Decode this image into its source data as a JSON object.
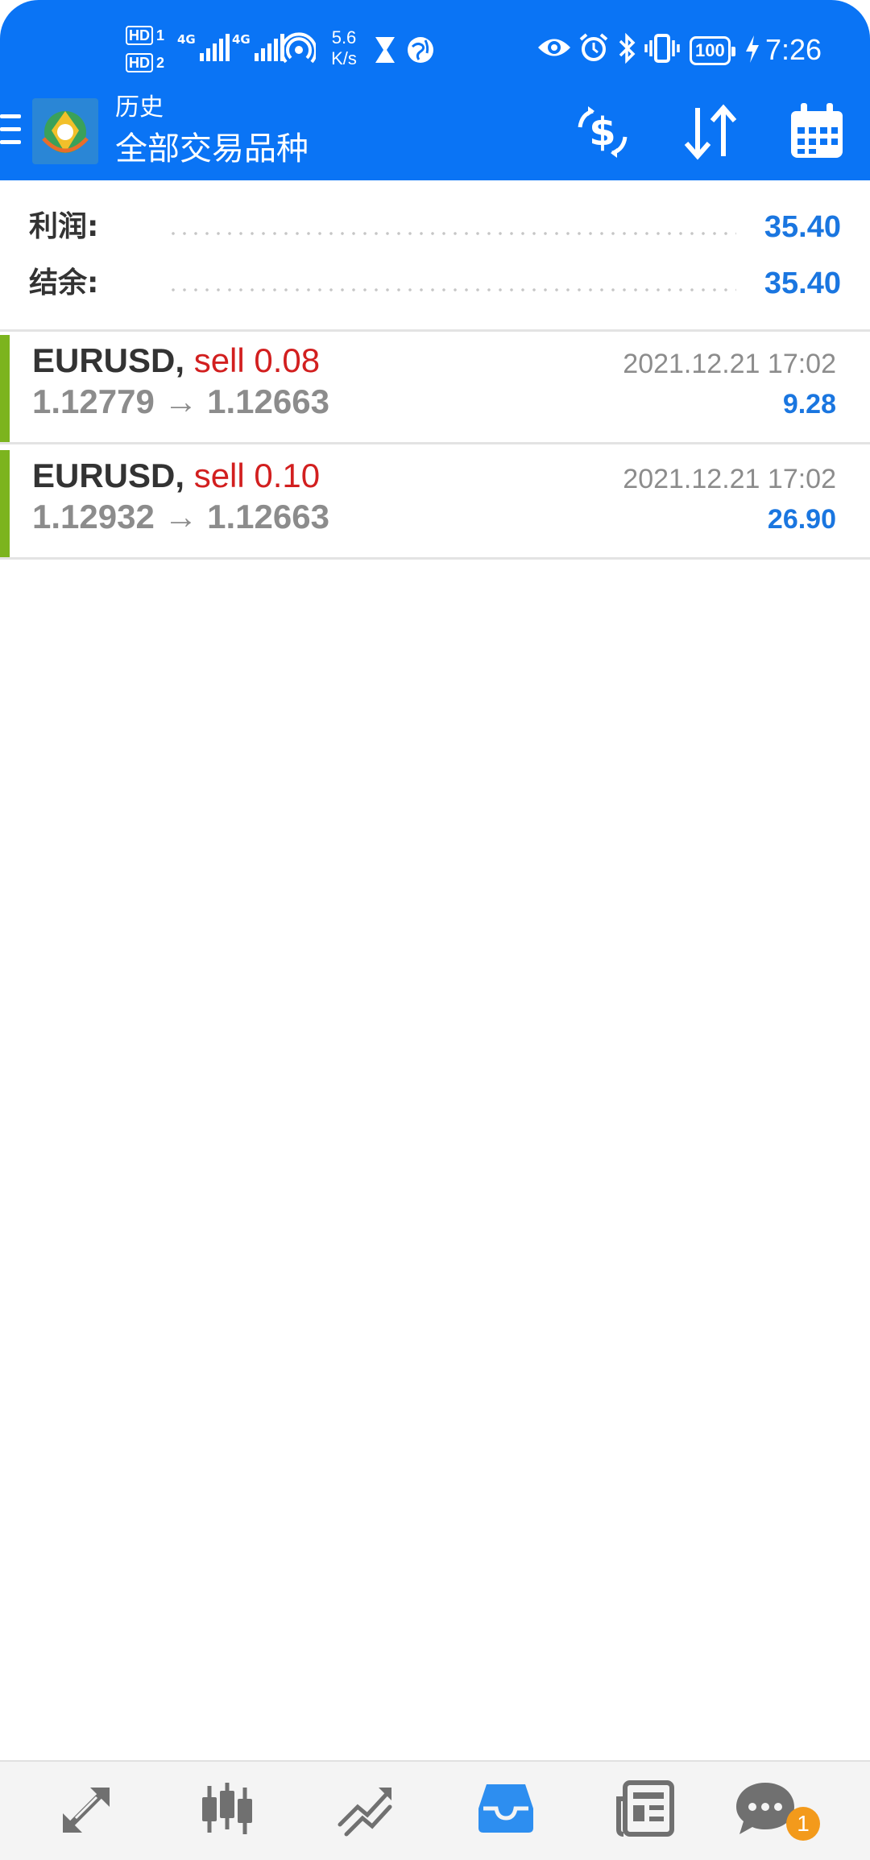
{
  "status_bar": {
    "hd1": "HD",
    "hd1_num": "1",
    "hd2": "HD",
    "hd2_num": "2",
    "net1": "4G",
    "net2": "4G",
    "speed_value": "5.6",
    "speed_unit": "K/s",
    "battery": "100",
    "time": "7:26"
  },
  "toolbar": {
    "subtitle": "历史",
    "title": "全部交易品种",
    "icons": [
      "menu-icon",
      "app-logo",
      "currency-exchange-icon",
      "sort-icon",
      "calendar-icon"
    ]
  },
  "summary": {
    "profit_label": "利润:",
    "profit_value": "35.40",
    "balance_label": "结余:",
    "balance_value": "35.40"
  },
  "trades": [
    {
      "symbol": "EURUSD,",
      "side": "sell 0.08",
      "prices": "1.12779 → 1.12663",
      "time": "2021.12.21 17:02",
      "profit": "9.28"
    },
    {
      "symbol": "EURUSD,",
      "side": "sell 0.10",
      "prices": "1.12932 → 1.12663",
      "time": "2021.12.21 17:02",
      "profit": "26.90"
    }
  ],
  "bottom_nav": {
    "items": [
      "quotes-icon",
      "chart-icon",
      "trade-icon",
      "history-icon",
      "news-icon",
      "chat-icon"
    ],
    "active": "history-icon",
    "chat_badge": "1"
  },
  "colors": {
    "header_bg": "#0a74f5",
    "accent_blue": "#1a76e0",
    "sell_red": "#d21f1f",
    "row_marker_green": "#7cb41e",
    "badge_orange": "#f39a1b"
  }
}
